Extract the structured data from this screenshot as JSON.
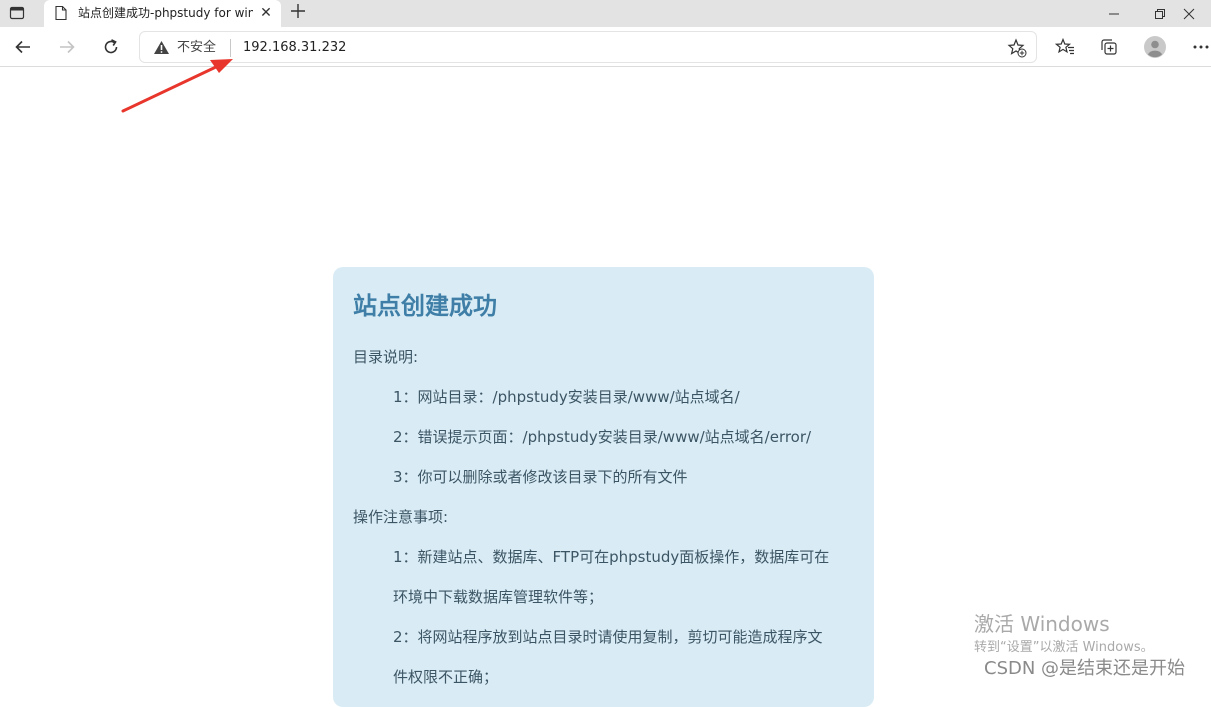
{
  "browser": {
    "tab_title": "站点创建成功-phpstudy for windows",
    "security_label": "不安全",
    "url": "192.168.31.232"
  },
  "page": {
    "heading": "站点创建成功",
    "dir_title": "目录说明:",
    "dir_items": [
      "1：网站目录：/phpstudy安装目录/www/站点域名/",
      "2：错误提示页面：/phpstudy安装目录/www/站点域名/error/",
      "3：你可以删除或者修改该目录下的所有文件"
    ],
    "ops_title": "操作注意事项:",
    "ops_lines": [
      "1：新建站点、数据库、FTP可在phpstudy面板操作，数据库可在",
      "环境中下载数据库管理软件等；",
      "2：将网站程序放到站点目录时请使用复制，剪切可能造成程序文",
      "件权限不正确；"
    ]
  },
  "overlay": {
    "activate_title": "激活 Windows",
    "activate_sub": "转到“设置”以激活 Windows。",
    "csdn": "CSDN @是结束还是开始"
  },
  "colors": {
    "card_bg": "#d9ecf5",
    "heading": "#3f7fa7",
    "annotation_arrow": "#e8362c"
  },
  "icons": [
    "sidebar-toggle-icon",
    "page-icon",
    "close-icon",
    "plus-icon",
    "minimize-icon",
    "restore-icon",
    "window-close-icon",
    "back-arrow-icon",
    "forward-arrow-icon",
    "refresh-icon",
    "warning-icon",
    "favorite-add-icon",
    "favorites-icon",
    "collections-icon",
    "profile-avatar-icon",
    "more-icon"
  ]
}
